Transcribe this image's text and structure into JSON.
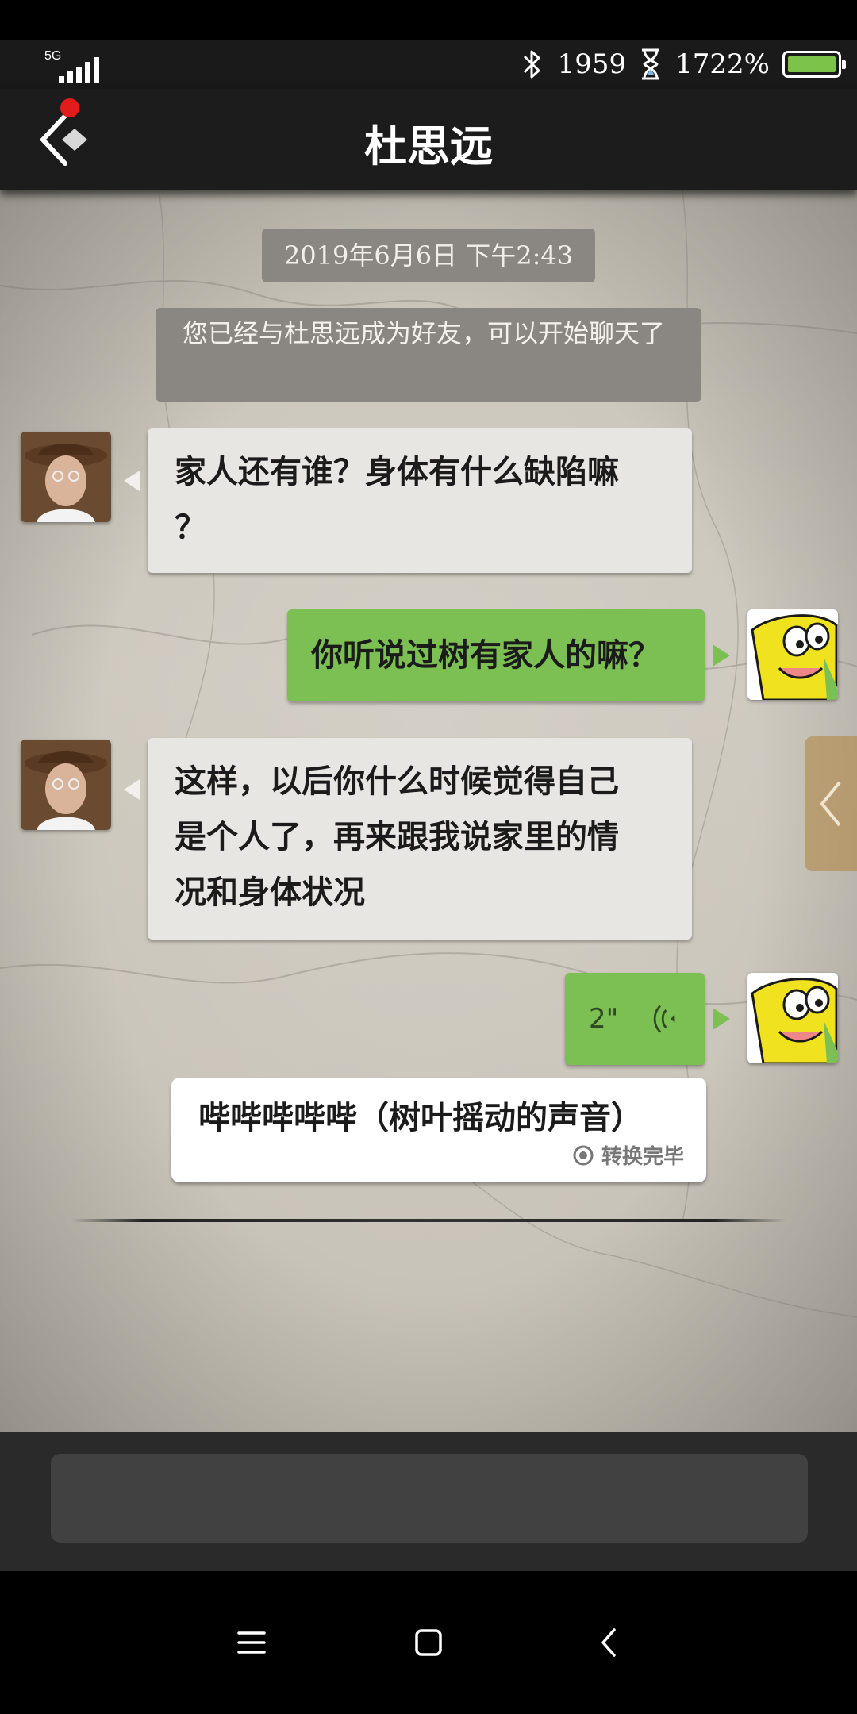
{
  "status_bar": {
    "network": "5G",
    "step_count": "1959",
    "battery_percent": "1722%",
    "battery_level": 1.0,
    "icons": [
      "signal-icon",
      "bluetooth-icon",
      "hourglass-icon",
      "battery-icon"
    ]
  },
  "header": {
    "title": "杜思远",
    "back_icon": "back-diamond-icon",
    "notification_dot_color": "#e21b1b"
  },
  "chat": {
    "timestamp": "2019年6月6日 下午2:43",
    "system_message": "您已经与杜思远成为好友，可以开始聊天了",
    "messages": [
      {
        "from": "contact",
        "text_lines": [
          "家人还有谁？身体有什么缺陷嘛",
          "？"
        ]
      },
      {
        "from": "me",
        "text": "你听说过树有家人的嘛？"
      },
      {
        "from": "contact",
        "text_lines": [
          "这样，以后你什么时候觉得自己",
          "是个人了，再来跟我说家里的情",
          "况和身体状况"
        ]
      },
      {
        "from": "me",
        "type": "voice",
        "duration": "2\""
      }
    ],
    "transcription": {
      "text": "哔哔哔哔哔（树叶摇动的声音）",
      "status": "转换完毕"
    }
  },
  "composer": {
    "placeholder": ""
  },
  "colors": {
    "my_bubble": "#7cbf52",
    "contact_bubble": "#e8e6e2",
    "header_bg": "#1c1c1c"
  },
  "nav_bar": {
    "icons": [
      "menu-icon",
      "home-icon",
      "back-icon"
    ]
  }
}
